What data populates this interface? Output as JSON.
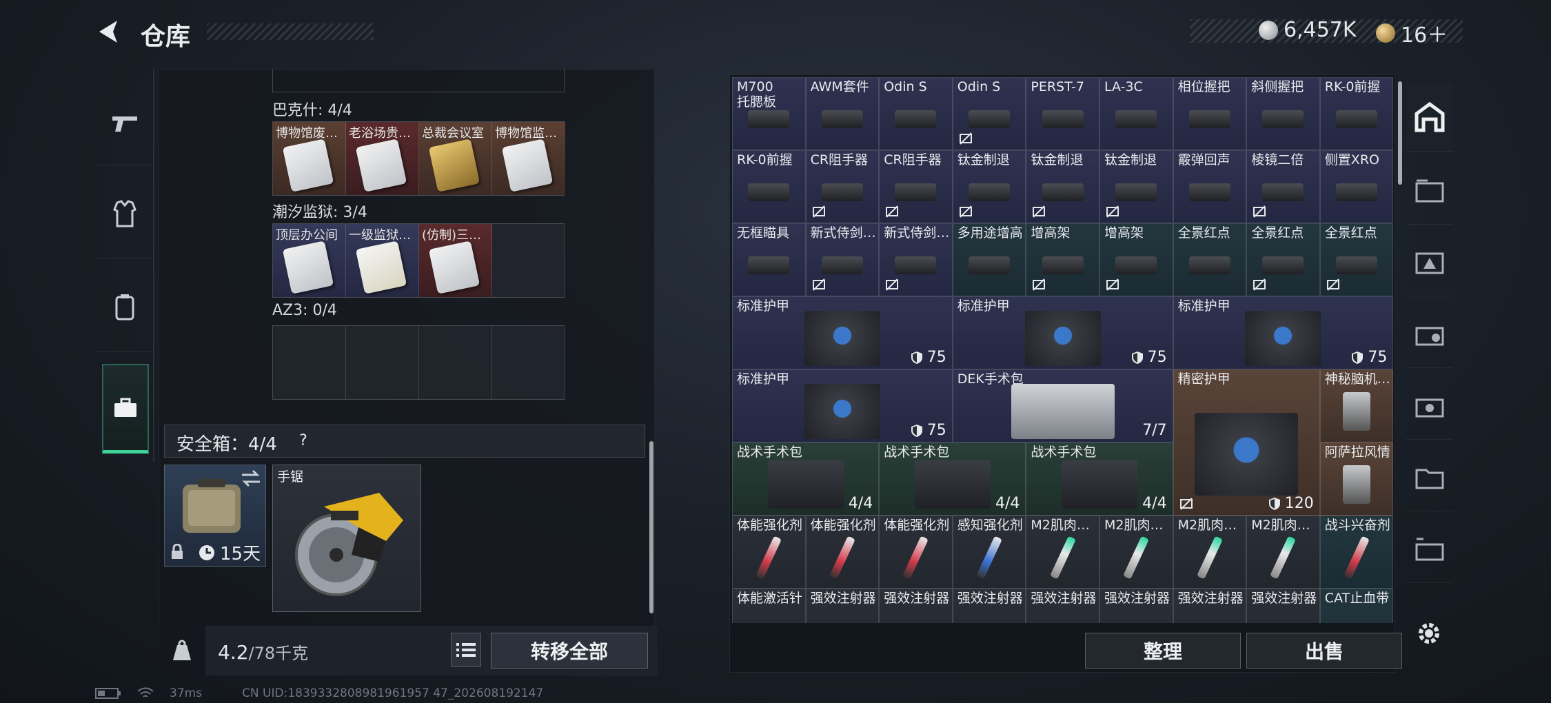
{
  "header": {
    "title": "仓库",
    "currency_1": "6,457K",
    "currency_2": "16＋"
  },
  "left": {
    "groups": [
      {
        "label": "巴克什: 4/4",
        "items": [
          {
            "name": "博物馆废…",
            "color": "orange",
            "card": "white"
          },
          {
            "name": "老浴场贵…",
            "color": "red",
            "card": "white"
          },
          {
            "name": "总裁会议室",
            "color": "orange",
            "card": "gold"
          },
          {
            "name": "博物馆监…",
            "color": "orange",
            "card": "white"
          }
        ]
      },
      {
        "label": "潮汐监狱: 3/4",
        "items": [
          {
            "name": "顶层办公间",
            "color": "blue",
            "card": "white"
          },
          {
            "name": "一级监狱…",
            "color": "blue",
            "card": "yel"
          },
          {
            "name": "(仿制)三…",
            "color": "red",
            "card": "white"
          },
          {
            "name": "",
            "color": "empty",
            "card": ""
          }
        ]
      },
      {
        "label": "AZ3: 0/4",
        "items": [
          {
            "name": "",
            "color": "empty",
            "card": ""
          },
          {
            "name": "",
            "color": "empty",
            "card": ""
          },
          {
            "name": "",
            "color": "empty",
            "card": ""
          },
          {
            "name": "",
            "color": "empty",
            "card": ""
          }
        ]
      }
    ],
    "safe_box_label": "安全箱：4/4",
    "safe_help": "?",
    "safe_case_days": "15天",
    "saw_name": "手锯",
    "weight_value": "4.2",
    "weight_unit": "/78千克",
    "transfer_all": "转移全部"
  },
  "inventory": [
    {
      "name": "M700\n托腮板",
      "c": "blue",
      "nosell": false
    },
    {
      "name": "AWM套件",
      "c": "blue",
      "nosell": false
    },
    {
      "name": "Odin S",
      "c": "blue",
      "nosell": false
    },
    {
      "name": "Odin S",
      "c": "blue",
      "nosell": true
    },
    {
      "name": "PERST-7",
      "c": "blue",
      "nosell": false
    },
    {
      "name": "LA-3C",
      "c": "blue",
      "nosell": false
    },
    {
      "name": "相位握把",
      "c": "blue",
      "nosell": false
    },
    {
      "name": "斜侧握把",
      "c": "blue",
      "nosell": false
    },
    {
      "name": "RK-0前握",
      "c": "blue",
      "nosell": false
    },
    {
      "name": "RK-0前握",
      "c": "blue",
      "nosell": false
    },
    {
      "name": "CR阻手器",
      "c": "blue",
      "nosell": true
    },
    {
      "name": "CR阻手器",
      "c": "blue",
      "nosell": true
    },
    {
      "name": "钛金制退",
      "c": "blue",
      "nosell": true
    },
    {
      "name": "钛金制退",
      "c": "blue",
      "nosell": true
    },
    {
      "name": "钛金制退",
      "c": "blue",
      "nosell": true
    },
    {
      "name": "霰弹回声",
      "c": "blue",
      "nosell": false
    },
    {
      "name": "棱镜二倍",
      "c": "blue",
      "nosell": true
    },
    {
      "name": "侧置XRO",
      "c": "blue",
      "nosell": false
    },
    {
      "name": "无框瞄具",
      "c": "blue",
      "nosell": false
    },
    {
      "name": "新式侍剑…",
      "c": "blue",
      "nosell": true
    },
    {
      "name": "新式侍剑…",
      "c": "blue",
      "nosell": true
    },
    {
      "name": "多用途增高",
      "c": "teal",
      "nosell": false
    },
    {
      "name": "增高架",
      "c": "teal",
      "nosell": true
    },
    {
      "name": "增高架",
      "c": "teal",
      "nosell": true
    },
    {
      "name": "全景红点",
      "c": "teal",
      "nosell": false
    },
    {
      "name": "全景红点",
      "c": "teal",
      "nosell": true
    },
    {
      "name": "全景红点",
      "c": "teal",
      "nosell": true
    }
  ],
  "big_items": [
    {
      "name": "标准护甲",
      "count": "75"
    },
    {
      "name": "标准护甲",
      "count": "75"
    },
    {
      "name": "标准护甲",
      "count": "75"
    },
    {
      "name": "标准护甲",
      "count": "75"
    },
    {
      "name": "DEK手术包",
      "count": "7/7"
    },
    {
      "name": "精密护甲",
      "count": "120"
    },
    {
      "name": "神秘脑机…",
      "count": ""
    },
    {
      "name": "阿萨拉风情",
      "count": ""
    },
    {
      "name": "战术手术包",
      "count": "4/4"
    },
    {
      "name": "战术手术包",
      "count": "4/4"
    },
    {
      "name": "战术手术包",
      "count": "4/4"
    }
  ],
  "injectors": [
    "体能强化剂",
    "体能强化剂",
    "体能强化剂",
    "感知强化剂",
    "M2肌肉…",
    "M2肌肉…",
    "M2肌肉…",
    "M2肌肉…",
    "战斗兴奋剂"
  ],
  "last_row": [
    "体能激活针",
    "强效注射器",
    "强效注射器",
    "强效注射器",
    "强效注射器",
    "强效注射器",
    "强效注射器",
    "强效注射器",
    "CAT止血带"
  ],
  "buttons": {
    "sort": "整理",
    "sell": "出售"
  },
  "status": {
    "ping": "37ms",
    "uid": "CN UID:1839332808981961957 47_202608192147"
  }
}
